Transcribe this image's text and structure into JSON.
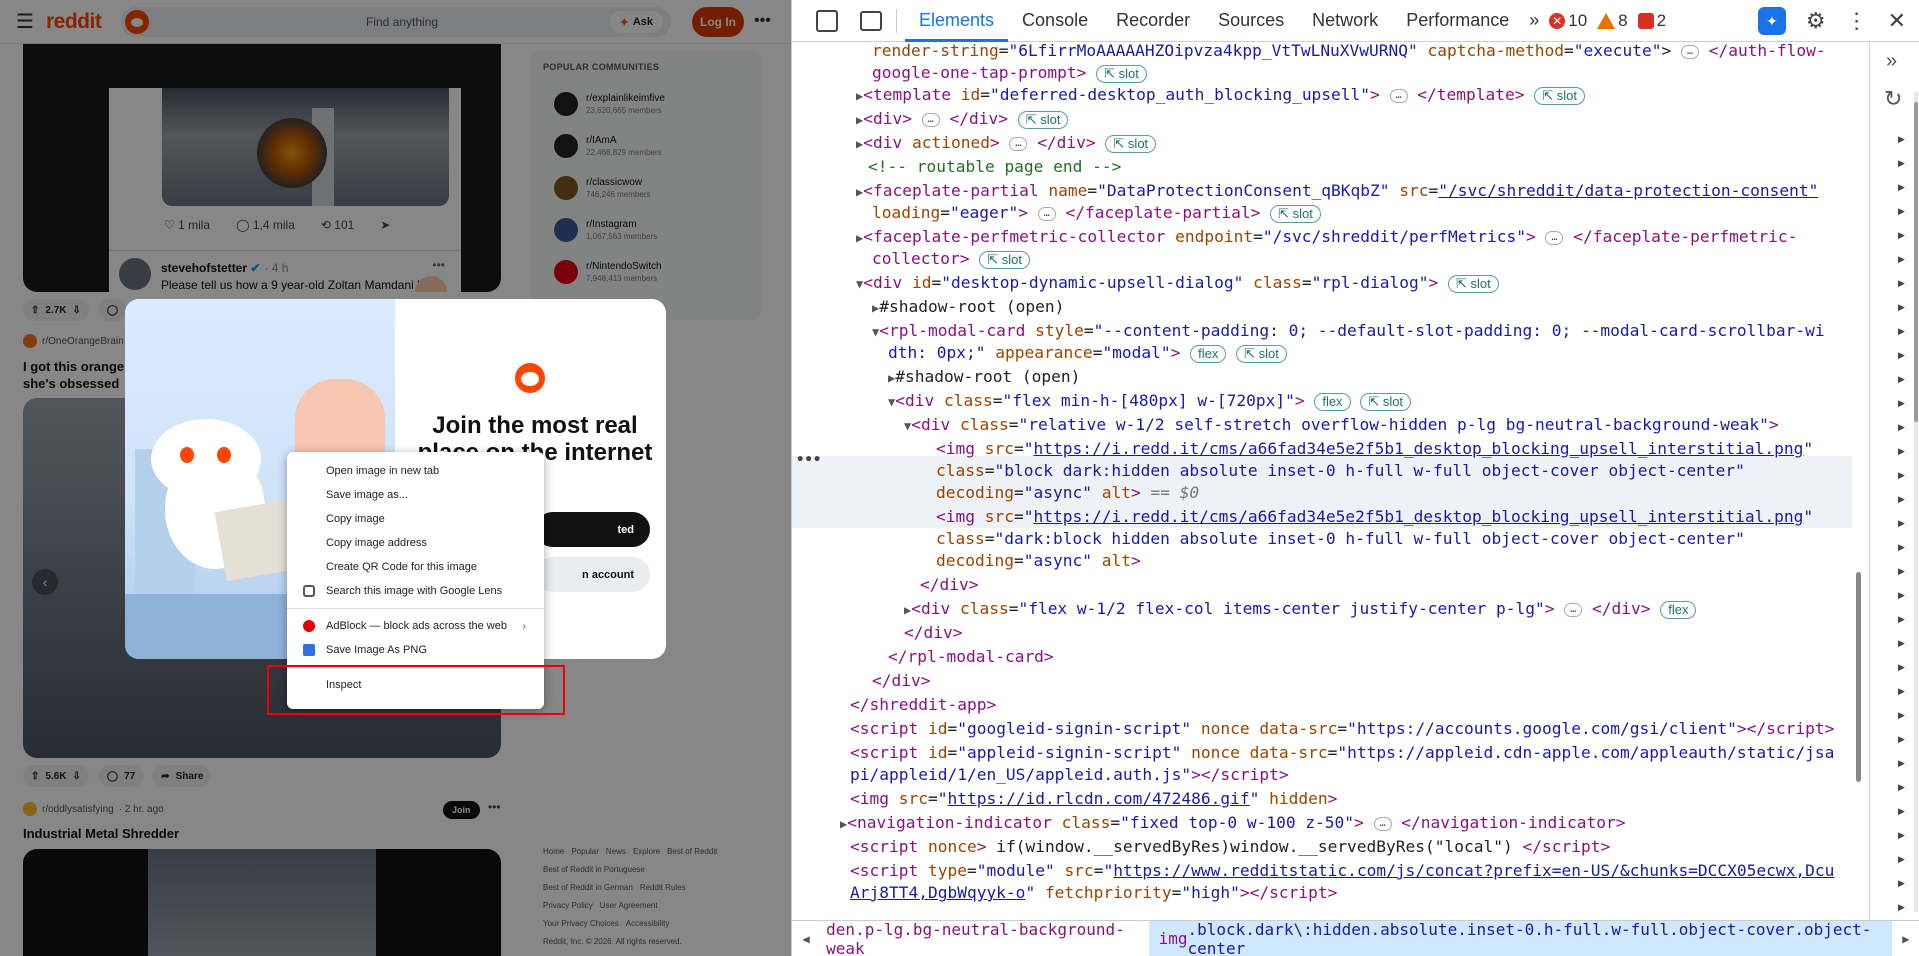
{
  "reddit": {
    "logo": "reddit",
    "search_placeholder": "Find anything",
    "ask_label": "Ask",
    "login_label": "Log In",
    "tweet": {
      "likes": "1 mila",
      "replies": "1,4 mila",
      "reposts": "101",
      "author": "stevehofstetter",
      "time": "· 4 h",
      "text": "Please tell us how a 9 year-old Zoltan Mamdani had anything to do with 9/11."
    },
    "post1": {
      "upvotes": "2.7K"
    },
    "post2": {
      "subreddit": "r/OneOrangeBrain",
      "title": "I got this orange she's obsessed"
    },
    "post2_stats": {
      "upvotes": "5.6K",
      "comments": "77",
      "share": "Share"
    },
    "post3": {
      "subreddit": "r/oddlysatisfying",
      "time": "· 2 hr. ago",
      "join": "Join",
      "title": "Industrial Metal Shredder"
    },
    "popular": {
      "title": "POPULAR COMMUNITIES",
      "items": [
        {
          "name": "r/explainlikeimfive",
          "members": "23,620,665 members"
        },
        {
          "name": "r/IAmA",
          "members": "22,468,829 members"
        },
        {
          "name": "r/classicwow",
          "members": "746,246 members"
        },
        {
          "name": "r/Instagram",
          "members": "1,067,563 members"
        },
        {
          "name": "r/NintendoSwitch",
          "members": "7,948,413 members"
        }
      ]
    },
    "footer": {
      "links": [
        "Home",
        "Popular",
        "News",
        "Explore",
        "Best of Reddit",
        "Best of Reddit in Portuguese",
        "Best of Reddit in German",
        "Reddit Rules",
        "Privacy Policy",
        "User Agreement",
        "Your Privacy Choices",
        "Accessibility"
      ],
      "copyright": "Reddit, Inc. © 2026. All rights reserved."
    },
    "modal": {
      "title": "Join the most real place on the internet",
      "continue_label": "ted",
      "login_label": "n account"
    },
    "context_menu": [
      {
        "label": "Open image in new tab"
      },
      {
        "label": "Save image as..."
      },
      {
        "label": "Copy image"
      },
      {
        "label": "Copy image address"
      },
      {
        "label": "Create QR Code for this image"
      },
      {
        "label": "Search this image with Google Lens",
        "icon": "google-lens-icon"
      },
      {
        "label": "AdBlock — block ads across the web",
        "icon": "adblock-icon",
        "submenu": true
      },
      {
        "label": "Save Image As PNG",
        "icon": "save-png-icon"
      },
      {
        "label": "Inspect"
      }
    ]
  },
  "devtools": {
    "tabs": [
      "Elements",
      "Console",
      "Recorder",
      "Sources",
      "Network",
      "Performance"
    ],
    "active_tab": "Elements",
    "errors": "10",
    "warnings": "8",
    "issues": "2",
    "breadcrumb_prev": "den.p-lg.bg-neutral-background-weak",
    "breadcrumb_current_tag": "img",
    "breadcrumb_current": ".block.dark\\:hidden.absolute.inset-0.h-full.w-full.object-cover.object-center"
  },
  "colors": {
    "reddit_orange": "#ff4500",
    "devtools_blue": "#1a73e8",
    "highlight_red": "#e00000"
  }
}
